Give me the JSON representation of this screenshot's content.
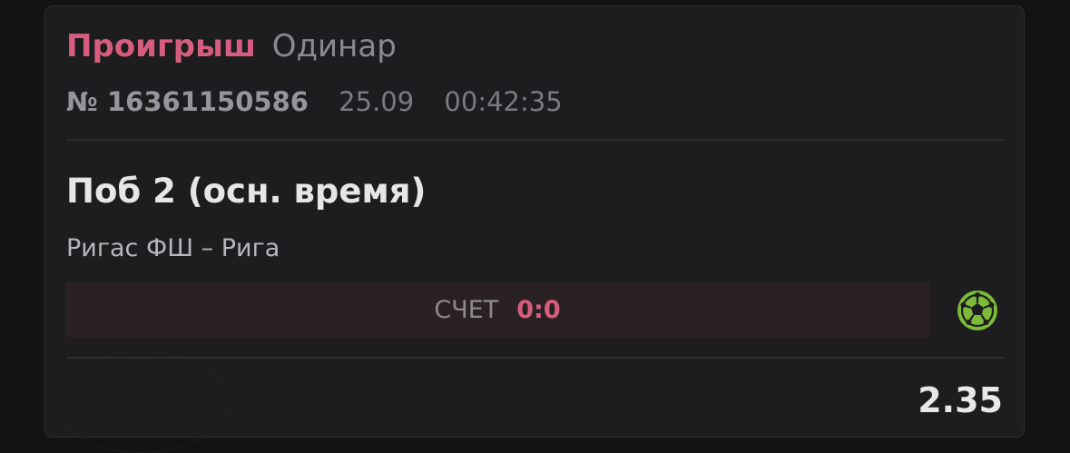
{
  "bet": {
    "status": "Проигрыш",
    "type": "Одинар",
    "number": "№ 16361150586",
    "date": "25.09",
    "time": "00:42:35",
    "title": "Поб 2 (осн. время)",
    "match": "Ригас ФШ – Рига",
    "score_label": "СЧЕТ",
    "score_value": "0:0",
    "odds": "2.35",
    "sport_icon": "soccer-ball-icon"
  },
  "colors": {
    "lost": "#d75d7e",
    "sport_icon": "#7cba3a",
    "background": "#1d1c1e"
  }
}
